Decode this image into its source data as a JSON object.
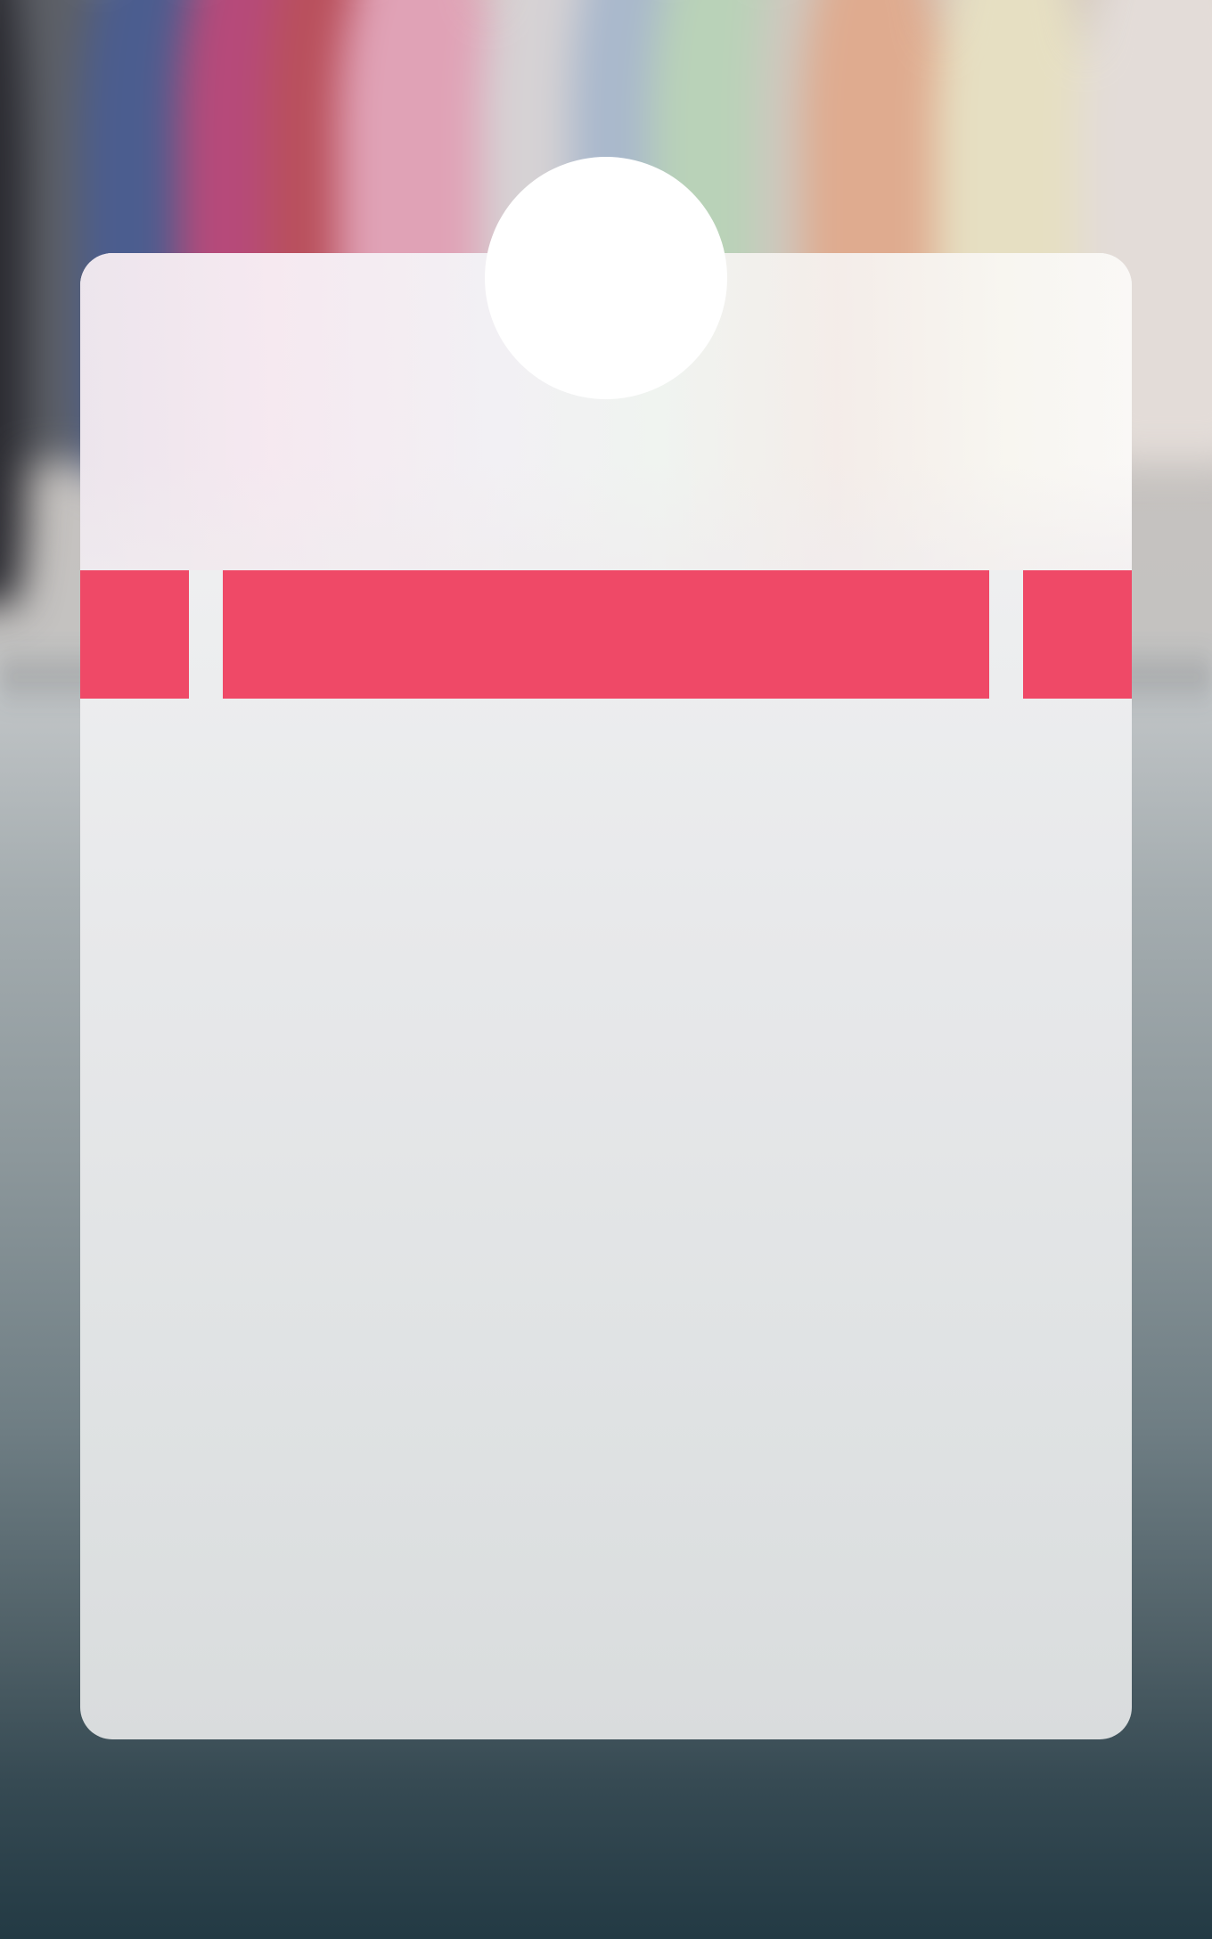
{
  "colors": {
    "accent_red": "#ef4967",
    "card_surface": "#eeeff0",
    "avatar_fill": "#ffffff",
    "background_bottom": "#233a44"
  },
  "carousel": {
    "tabs": [
      {
        "label": ""
      },
      {
        "label": ""
      },
      {
        "label": ""
      }
    ],
    "active_index": 1
  },
  "avatar": {
    "icon": "profile-photo-placeholder"
  }
}
